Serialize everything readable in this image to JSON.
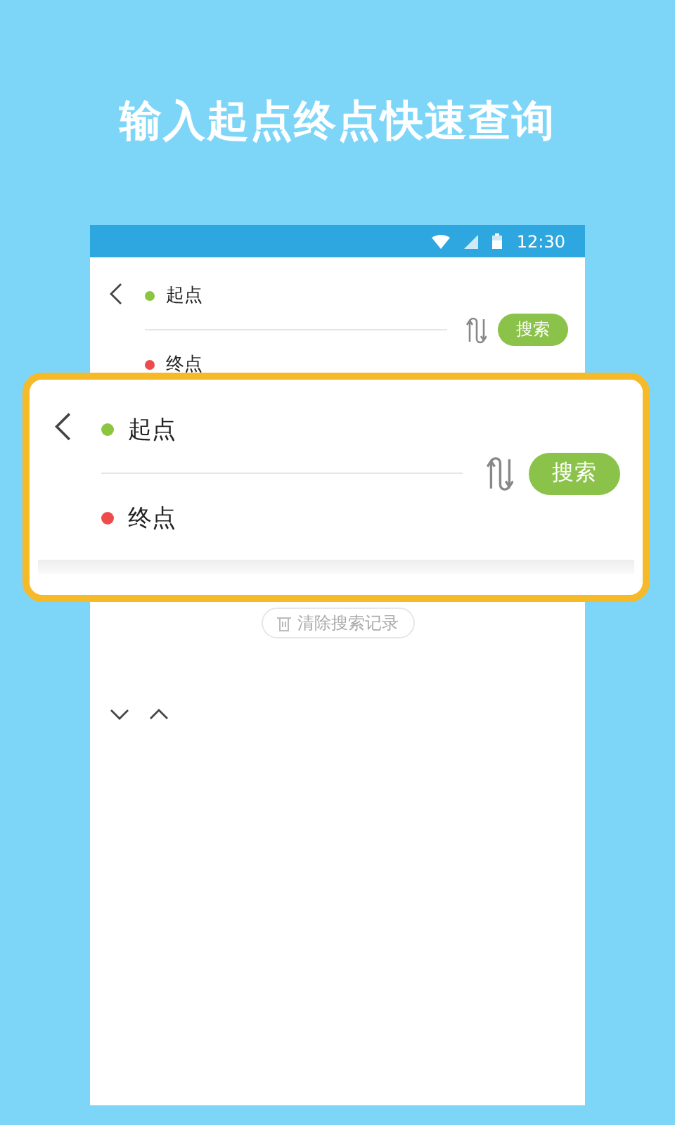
{
  "headline": "输入起点终点快速查询",
  "status_bar": {
    "time": "12:30"
  },
  "route_form": {
    "points": [
      {
        "label": "起点",
        "color": "#8cc63f"
      },
      {
        "label": "终点",
        "color": "#ee4c4c"
      }
    ],
    "search_button": "搜索"
  },
  "clear_history_button": "清除搜索记录",
  "zoomed_route_form": {
    "points": [
      {
        "label": "起点",
        "color": "#8cc63f"
      },
      {
        "label": "终点",
        "color": "#ee4c4c"
      }
    ],
    "search_button": "搜索"
  }
}
